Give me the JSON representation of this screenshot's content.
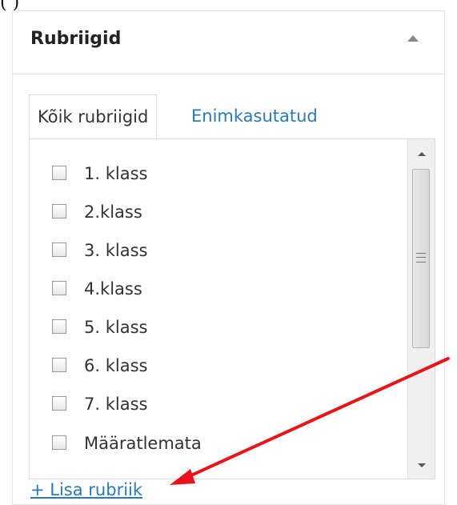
{
  "top_fragment": "(                )",
  "panel": {
    "title": "Rubriigid",
    "toggle_icon": "triangle-up-icon"
  },
  "tabs": [
    {
      "label": "Kõik rubriigid",
      "active": true
    },
    {
      "label": "Enimkasutatud",
      "active": false
    }
  ],
  "categories": [
    {
      "label": "1. klass",
      "checked": false
    },
    {
      "label": "2.klass",
      "checked": false
    },
    {
      "label": "3. klass",
      "checked": false
    },
    {
      "label": "4.klass",
      "checked": false
    },
    {
      "label": "5. klass",
      "checked": false
    },
    {
      "label": "6. klass",
      "checked": false
    },
    {
      "label": "7. klass",
      "checked": false
    },
    {
      "label": "Määratlemata",
      "checked": false
    }
  ],
  "add_link": "+ Lisa rubriik",
  "colors": {
    "link": "#2a7ab5",
    "annotation_arrow": "#e8141b"
  }
}
